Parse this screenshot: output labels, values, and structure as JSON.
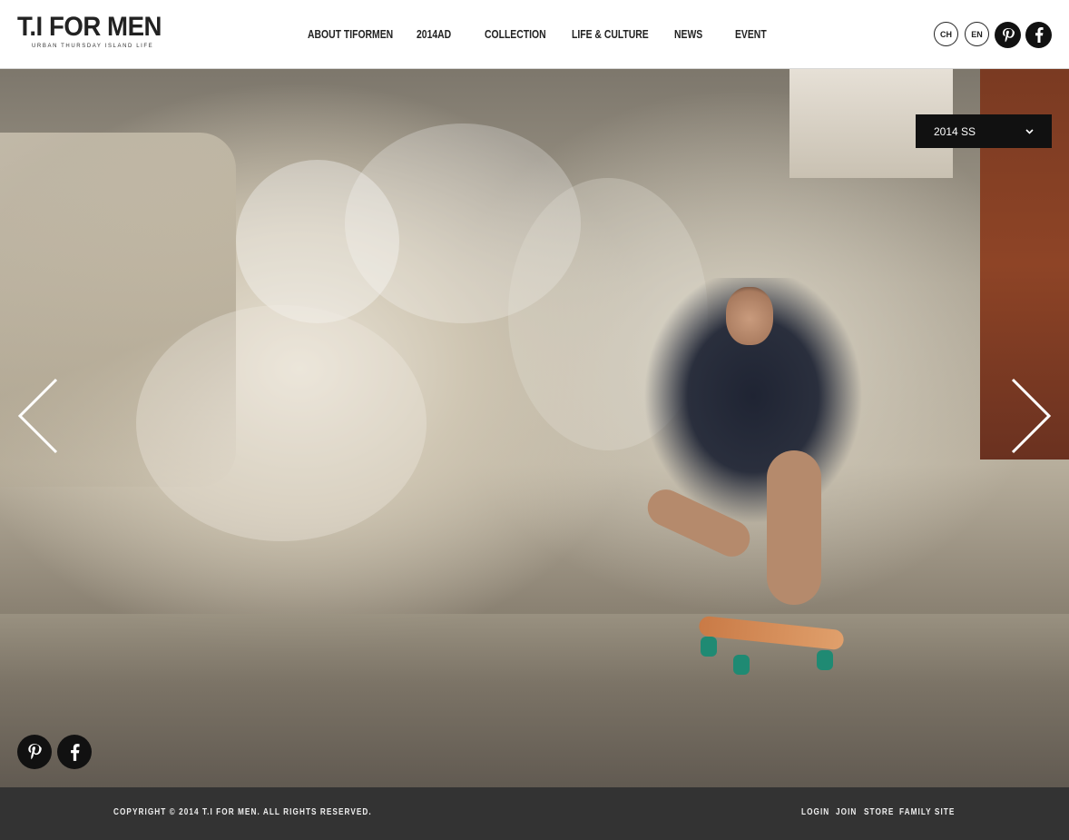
{
  "header": {
    "logo_main": "T.I FOR MEN",
    "logo_sub": "URBAN THURSDAY ISLAND LIFE",
    "nav": [
      {
        "label": "ABOUT TIFORMEN"
      },
      {
        "label": "2014AD"
      },
      {
        "label": "COLLECTION"
      },
      {
        "label": "LIFE & CULTURE"
      },
      {
        "label": "NEWS"
      },
      {
        "label": "EVENT"
      }
    ],
    "lang": [
      "CH",
      "EN"
    ],
    "social": [
      {
        "icon": "pinterest-icon",
        "glyph": "P"
      },
      {
        "icon": "facebook-icon",
        "glyph": "f"
      }
    ]
  },
  "hero": {
    "season_select": {
      "selected": "2014 SS",
      "icon": "chevron-down-icon"
    },
    "prev_icon": "chevron-left-icon",
    "next_icon": "chevron-right-icon",
    "social": [
      {
        "icon": "pinterest-icon",
        "glyph": "P"
      },
      {
        "icon": "facebook-icon",
        "glyph": "f"
      }
    ]
  },
  "footer": {
    "copyright": "COPYRIGHT © 2014 T.I FOR MEN. ALL RIGHTS RESERVED.",
    "links": [
      {
        "label": "LOGIN"
      },
      {
        "label": "JOIN"
      },
      {
        "label": "STORE"
      },
      {
        "label": "FAMILY SITE"
      }
    ]
  },
  "colors": {
    "header_bg": "#ffffff",
    "text_dark": "#222222",
    "select_bg": "#111111",
    "footer_bg": "#333333",
    "footer_text": "#eeeeee"
  }
}
